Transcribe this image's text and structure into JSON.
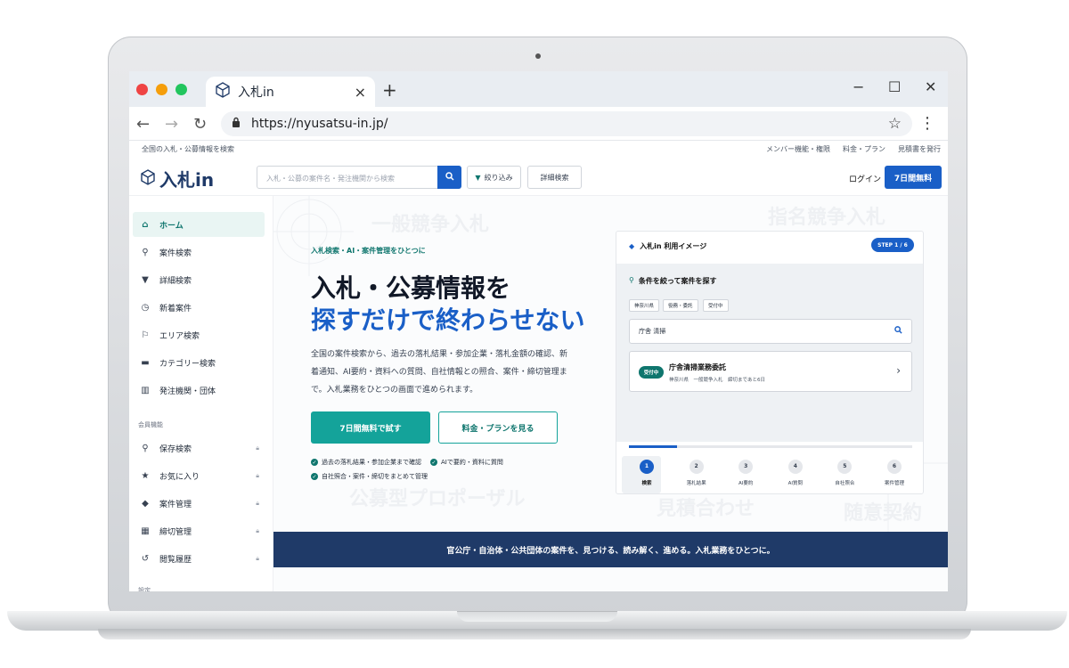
{
  "browser": {
    "tab_title": "入札in",
    "tab_close": "×",
    "new_tab": "+",
    "url": "https://nyusatsu-in.jp/",
    "window_controls": [
      "−",
      "☐",
      "✕"
    ]
  },
  "site": {
    "tagline": "全国の入札・公募情報を検索",
    "top_links": [
      "メンバー機能・権限",
      "料金・プラン",
      "見積書を発行"
    ],
    "logo_text": "入札in",
    "search_placeholder": "入札・公募の案件名・発注機関から検索",
    "filter_label": "絞り込み",
    "advanced_label": "詳細検索",
    "login_label": "ログイン",
    "free_trial_label": "7日間無料"
  },
  "sidebar": {
    "items": [
      {
        "label": "ホーム",
        "icon": "home-icon"
      },
      {
        "label": "案件検索",
        "icon": "search-icon"
      },
      {
        "label": "詳細検索",
        "icon": "filter-icon"
      },
      {
        "label": "新着案件",
        "icon": "clock-icon"
      },
      {
        "label": "エリア検索",
        "icon": "pin-icon"
      },
      {
        "label": "カテゴリー検索",
        "icon": "folder-icon"
      },
      {
        "label": "発注機関・団体",
        "icon": "building-icon"
      }
    ],
    "member_heading": "会員機能",
    "member_items": [
      {
        "label": "保存検索",
        "icon": "search-icon"
      },
      {
        "label": "お気に入り",
        "icon": "star-icon"
      },
      {
        "label": "案件管理",
        "icon": "tag-icon"
      },
      {
        "label": "締切管理",
        "icon": "calendar-icon"
      },
      {
        "label": "閲覧履歴",
        "icon": "history-icon"
      }
    ],
    "settings_heading": "設定"
  },
  "hero": {
    "eyebrow": "入札検索・AI・案件管理をひとつに",
    "title_line1": "入札・公募情報を",
    "title_line2": "探すだけで終わらせない",
    "description": "全国の案件検索から、過去の落札結果・参加企業・落札金額の確認、新着通知、AI要約・資料への質問、自社情報との照合、案件・締切管理まで。入札業務をひとつの画面で進められます。",
    "cta_primary": "7日間無料で試す",
    "cta_secondary": "料金・プランを見る",
    "checks": [
      "過去の落札結果・参加企業まで確認",
      "AIで要約・資料に質問",
      "自社照合・案件・締切をまとめて管理"
    ],
    "watermarks": [
      "一般競争入札",
      "指名競争入札",
      "公募型プロポーザル",
      "見積合わせ",
      "随意契約"
    ]
  },
  "demo": {
    "title": "入札in 利用イメージ",
    "step_badge": "STEP 1 / 6",
    "heading": "条件を絞って案件を探す",
    "chips": [
      "神奈川県",
      "役務・委託",
      "受付中"
    ],
    "query": "庁舎 清掃",
    "result": {
      "badge": "受付中",
      "title": "庁舎清掃業務委託",
      "meta": "神奈川県　一般競争入札　締切まであと6日"
    },
    "progress": 0.17,
    "steps": [
      {
        "n": "1",
        "label": "検索"
      },
      {
        "n": "2",
        "label": "落札結果"
      },
      {
        "n": "3",
        "label": "AI要約"
      },
      {
        "n": "4",
        "label": "AI質問"
      },
      {
        "n": "5",
        "label": "自社照合"
      },
      {
        "n": "6",
        "label": "案件管理"
      }
    ]
  },
  "banner": "官公庁・自治体・公共団体の案件を、見つける、読み解く、進める。入札業務をひとつに。",
  "colors": {
    "accent": "#1a5fc7",
    "teal": "#14a39a",
    "navy": "#1f3a68"
  }
}
